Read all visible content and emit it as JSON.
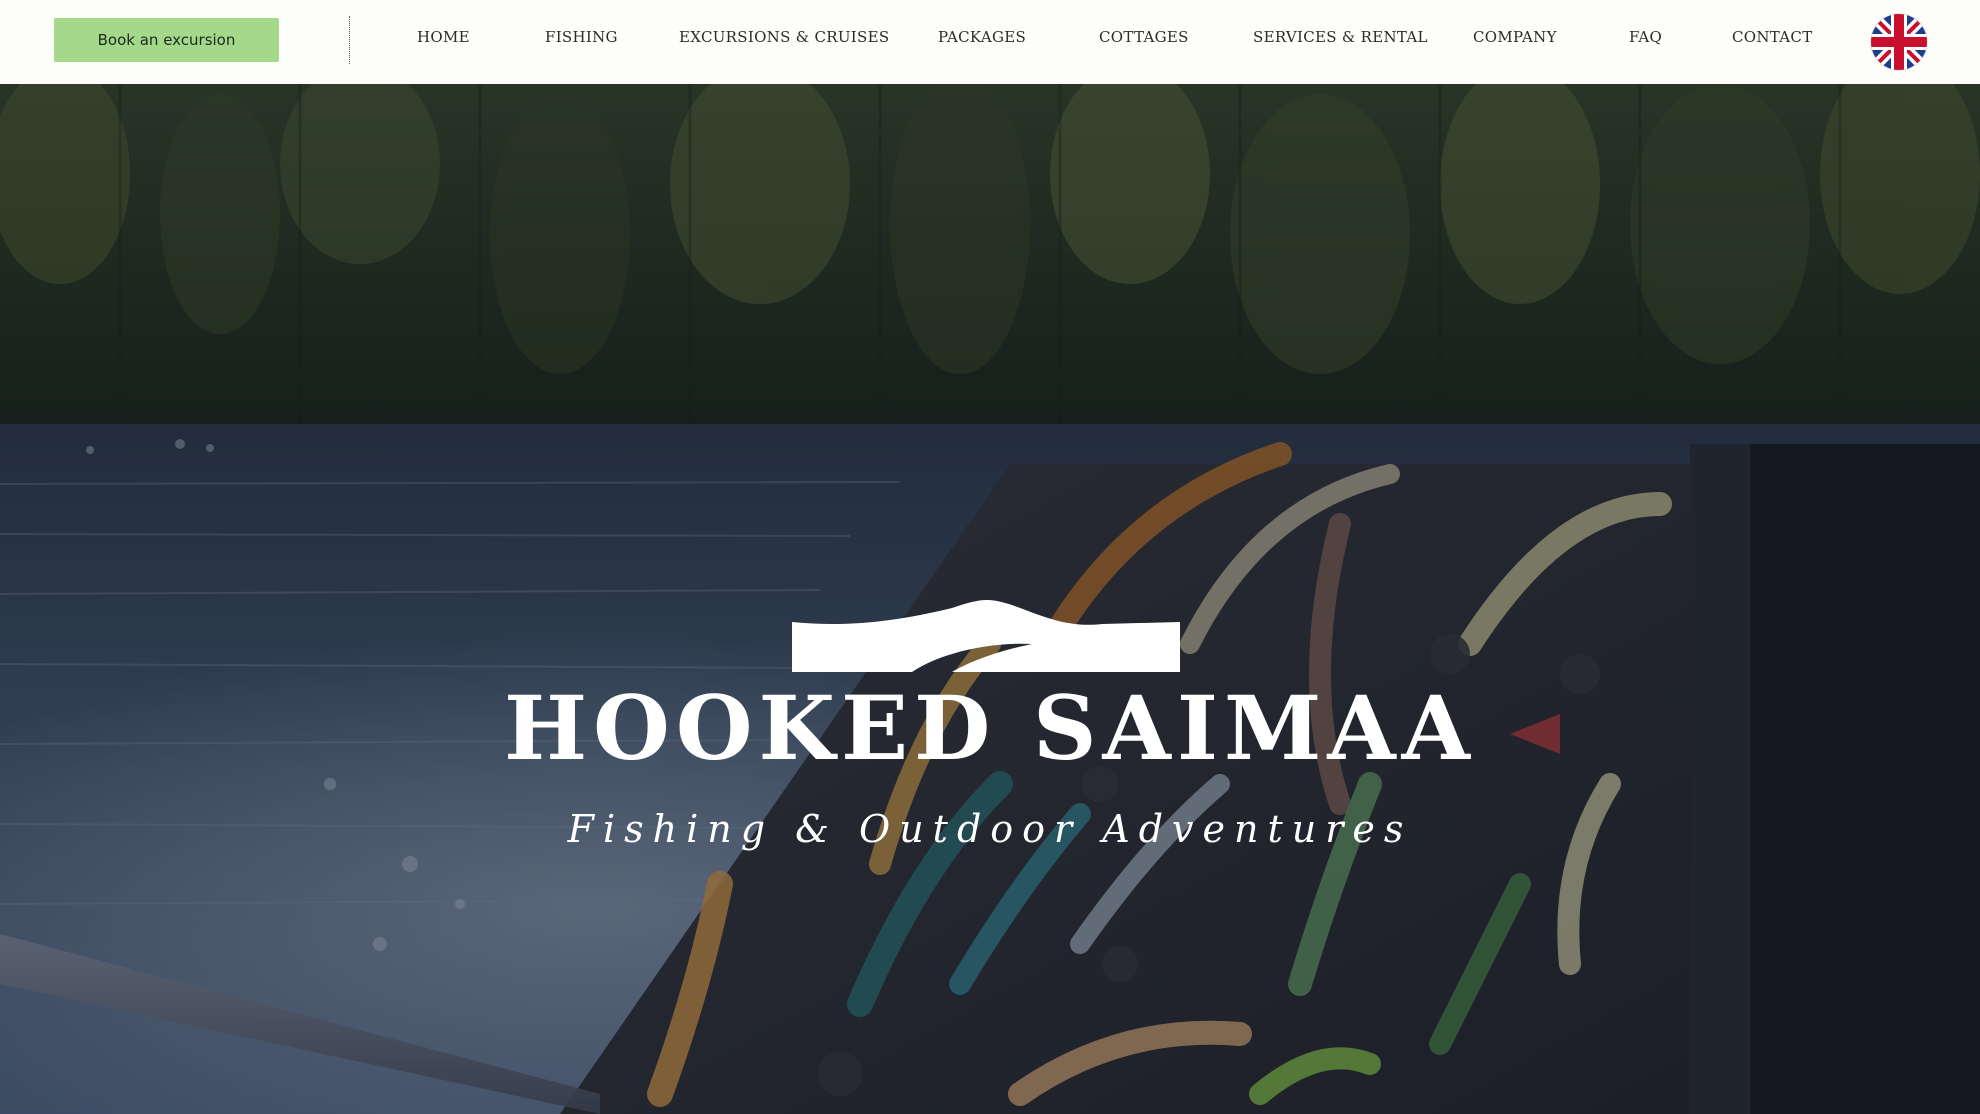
{
  "header": {
    "book_button": "Book an excursion",
    "nav": [
      {
        "label": "HOME"
      },
      {
        "label": "FISHING"
      },
      {
        "label": "EXCURSIONS & CRUISES"
      },
      {
        "label": "PACKAGES"
      },
      {
        "label": "COTTAGES"
      },
      {
        "label": "SERVICES & RENTAL"
      },
      {
        "label": "COMPANY"
      },
      {
        "label": "FAQ"
      },
      {
        "label": "CONTACT"
      }
    ],
    "language_icon": "uk-flag-icon"
  },
  "hero": {
    "brand_name": "HOOKED SAIMAA",
    "tagline": "Fishing & Outdoor Adventures",
    "logo_icon": "wave-logo-icon",
    "background": "lake-and-fishing-lures-photo"
  },
  "colors": {
    "header_bg": "#fdfdf9",
    "book_button_bg": "#a4d88a",
    "nav_text": "#2b2b2b",
    "hero_text": "#ffffff"
  }
}
